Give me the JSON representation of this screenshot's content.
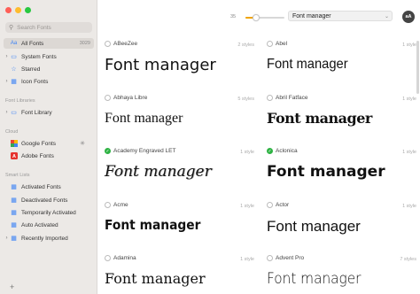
{
  "sidebar": {
    "search_placeholder": "Search Fonts",
    "items": [
      {
        "label": "All Fonts",
        "count": "3029"
      },
      {
        "label": "System Fonts"
      },
      {
        "label": "Starred"
      },
      {
        "label": "Icon Fonts"
      }
    ],
    "font_libraries_title": "Font Libraries",
    "font_library_label": "Font Library",
    "cloud_title": "Cloud",
    "cloud_items": [
      {
        "label": "Google Fonts"
      },
      {
        "label": "Adobe Fonts"
      }
    ],
    "smart_lists_title": "Smart Lists",
    "smart_items": [
      {
        "label": "Activated Fonts"
      },
      {
        "label": "Deactivated Fonts"
      },
      {
        "label": "Temporarily Activated"
      },
      {
        "label": "Auto Activated"
      },
      {
        "label": "Recently Imported"
      }
    ]
  },
  "toolbar": {
    "size_value": "35",
    "size_slider_fraction": 0.28,
    "preview_text": "Font manager",
    "aa_label": "aA"
  },
  "colors": {
    "accent": "#f0a400",
    "active_green": "#2fb344",
    "icon_blue": "#3b82f6"
  },
  "fonts": [
    {
      "name": "ABeeZee",
      "styles": "2 styles",
      "sample": "Font manager",
      "active": false
    },
    {
      "name": "Abel",
      "styles": "1 style",
      "sample": "Font manager",
      "active": false
    },
    {
      "name": "Abhaya Libre",
      "styles": "5 styles",
      "sample": "Font manager",
      "active": false
    },
    {
      "name": "Abril Fatface",
      "styles": "1 style",
      "sample": "Font manager",
      "active": false
    },
    {
      "name": "Academy Engraved LET",
      "styles": "1 style",
      "sample": "Font manager",
      "active": true
    },
    {
      "name": "Aclonica",
      "styles": "1 style",
      "sample": "Font manager",
      "active": true
    },
    {
      "name": "Acme",
      "styles": "1 style",
      "sample": "Font manager",
      "active": false
    },
    {
      "name": "Actor",
      "styles": "1 style",
      "sample": "Font manager",
      "active": false
    },
    {
      "name": "Adamina",
      "styles": "1 style",
      "sample": "Font manager",
      "active": false
    },
    {
      "name": "Advent Pro",
      "styles": "7 styles",
      "sample": "Font manager",
      "active": false
    }
  ]
}
